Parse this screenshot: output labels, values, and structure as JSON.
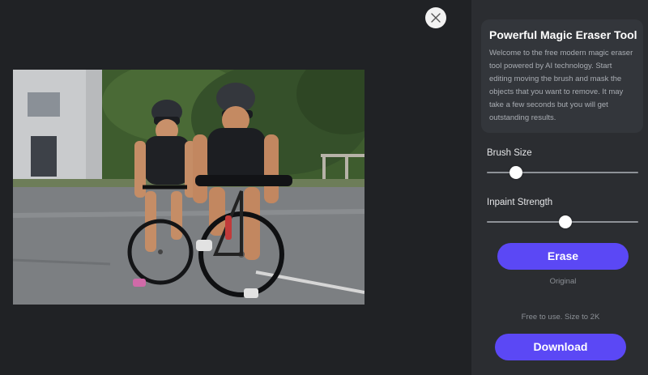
{
  "colors": {
    "accent": "#5b48f5",
    "panel_bg": "#2b2d31",
    "canvas_bg": "#202225",
    "card_bg": "#33363b"
  },
  "canvas": {
    "close_icon": "close-icon",
    "image_alt": "cyclists photo"
  },
  "panel": {
    "title": "Powerful Magic Eraser Tool",
    "description": "Welcome to the free modern magic eraser tool powered by AI technology. Start editing moving the brush and mask the objects that you want to remove. It may take a few seconds but you will get outstanding results.",
    "brush_size": {
      "label": "Brush Size",
      "value_fraction": 0.19
    },
    "inpaint_strength": {
      "label": "Inpaint Strength",
      "value_fraction": 0.52
    },
    "erase_label": "Erase",
    "original_label": "Original",
    "note": "Free to use. Size to 2K",
    "download_label": "Download"
  }
}
